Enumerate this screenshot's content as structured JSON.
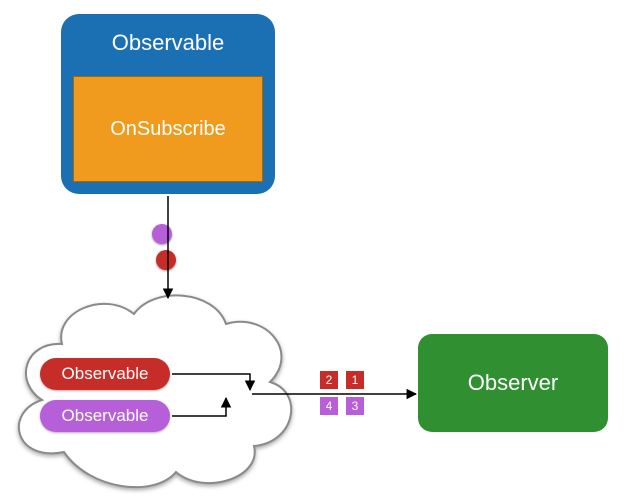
{
  "observable_top": {
    "title": "Observable",
    "onsubscribe_label": "OnSubscribe"
  },
  "cloud": {
    "inner_observables": [
      {
        "label": "Observable",
        "color": "#c72d28"
      },
      {
        "label": "Observable",
        "color": "#b65fd9"
      }
    ]
  },
  "emissions": {
    "dots": [
      {
        "color": "#b65fd9"
      },
      {
        "color": "#c72d28"
      }
    ],
    "chips": [
      {
        "value": "2",
        "color": "#c72d28"
      },
      {
        "value": "1",
        "color": "#c72d28"
      },
      {
        "value": "4",
        "color": "#b65fd9"
      },
      {
        "value": "3",
        "color": "#b65fd9"
      }
    ]
  },
  "observer": {
    "label": "Observer"
  },
  "colors": {
    "observable_bg": "#1b6fb3",
    "onsubscribe_bg": "#f09a1e",
    "red": "#c72d28",
    "purple": "#b65fd9",
    "green": "#2f8f31"
  }
}
